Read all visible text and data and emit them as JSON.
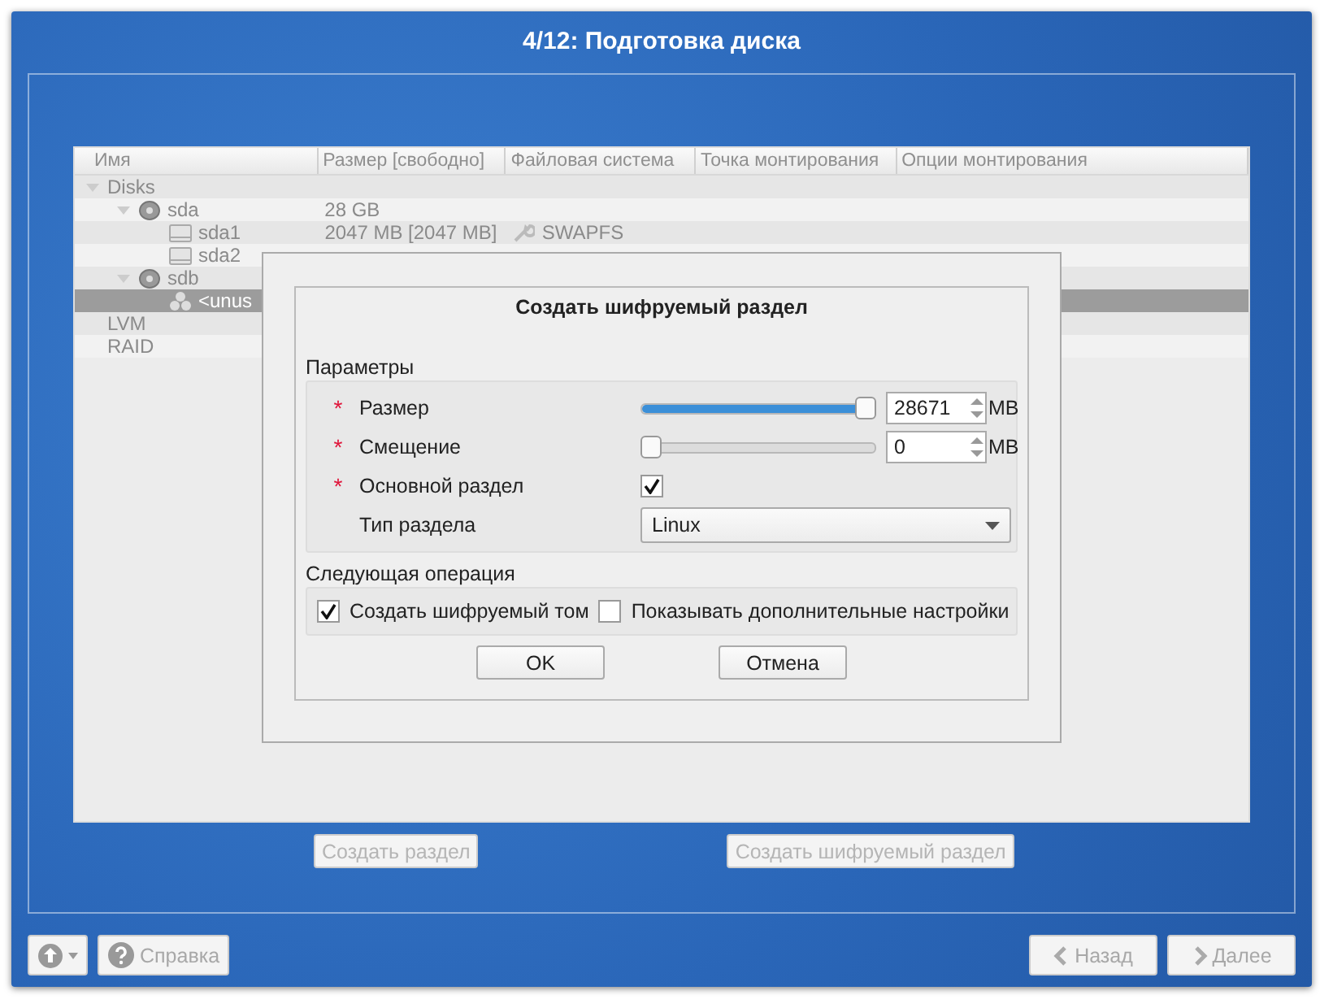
{
  "window": {
    "title": "4/12: Подготовка диска"
  },
  "tree": {
    "columns": [
      "Имя",
      "Размер [свободно]",
      "Файловая система",
      "Точка монтирования",
      "Опции монтирования"
    ],
    "rows": [
      {
        "name": "Disks",
        "expanded": true,
        "selected": false,
        "children": [
          {
            "name": "sda",
            "kind": "disk",
            "size": "28 GB",
            "expanded": true,
            "selected": false,
            "children": [
              {
                "name": "sda1",
                "kind": "partition",
                "size": "2047 MB [2047 MB]",
                "filesystem": "SWAPFS",
                "fs_icon": true,
                "selected": false
              },
              {
                "name": "sda2",
                "kind": "partition",
                "selected": false
              }
            ]
          },
          {
            "name": "sdb",
            "kind": "disk",
            "expanded": true,
            "selected": false,
            "children": [
              {
                "name": "<unus",
                "kind": "free",
                "selected": true
              }
            ]
          }
        ]
      },
      {
        "name": "LVM",
        "selected": false
      },
      {
        "name": "RAID",
        "selected": false
      }
    ]
  },
  "tree_buttons": [
    {
      "label": "Создать раздел",
      "disabled": true
    },
    {
      "label": "Создать шифруемый раздел",
      "disabled": true
    }
  ],
  "dialog": {
    "title": "Создать шифруемый раздел",
    "params_label": "Параметры",
    "required_mark": "*",
    "fields": [
      {
        "kind": "slider",
        "label": "Размер",
        "required": true,
        "level": 1,
        "value": "28671",
        "unit": "MB"
      },
      {
        "kind": "slider",
        "label": "Смещение",
        "required": true,
        "level": 0,
        "value": "0",
        "unit": "MB"
      },
      {
        "kind": "checkbox",
        "label": "Основной раздел",
        "required": true,
        "checked": true
      },
      {
        "kind": "select",
        "label": "Тип раздела",
        "required": false,
        "value": "Linux"
      }
    ],
    "next_label": "Следующая операция",
    "options": [
      {
        "label": "Создать шифруемый том",
        "checked": true
      },
      {
        "label": "Показывать дополнительные настройки",
        "checked": false
      }
    ],
    "buttons": [
      "OK",
      "Отмена"
    ]
  },
  "footer": {
    "left": [
      {
        "kind": "up",
        "disabled": true
      },
      {
        "kind": "help",
        "label": "Справка",
        "disabled": true
      }
    ],
    "right": [
      {
        "kind": "back",
        "label": "Назад",
        "disabled": true
      },
      {
        "kind": "next",
        "label": "Далее",
        "disabled": true
      }
    ]
  }
}
